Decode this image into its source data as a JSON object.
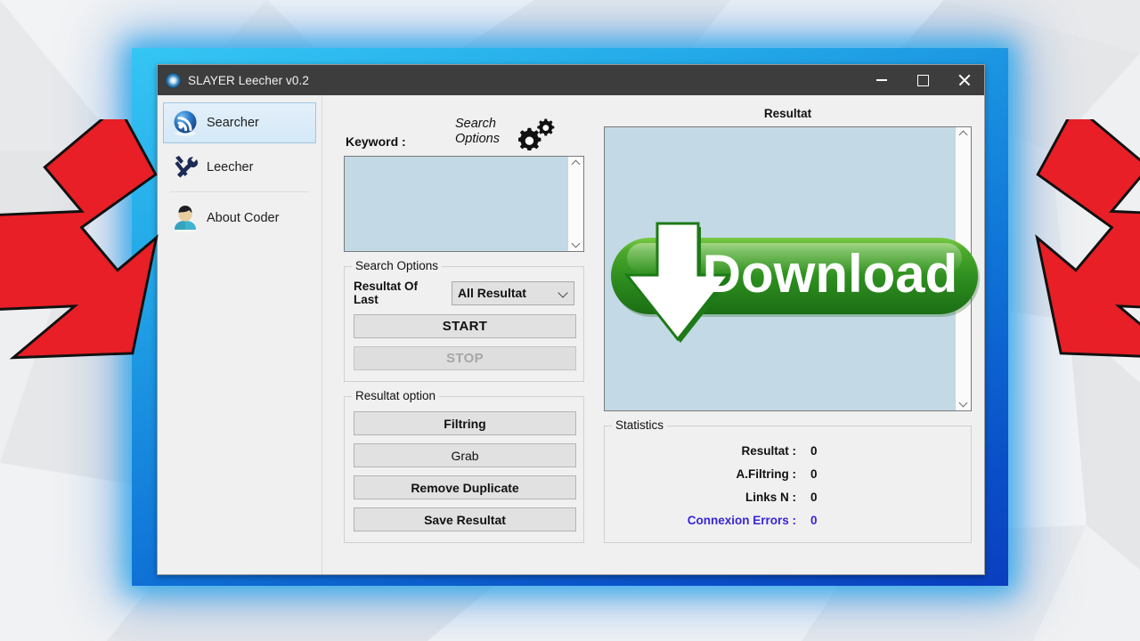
{
  "window": {
    "title": "SLAYER Leecher v0.2",
    "app_icon": "eye-icon",
    "controls": {
      "minimize": "minimize-icon",
      "maximize": "maximize-icon",
      "close": "close-icon"
    }
  },
  "sidebar": {
    "items": [
      {
        "label": "Searcher",
        "icon": "rss-sphere-icon",
        "selected": true
      },
      {
        "label": "Leecher",
        "icon": "hammer-wrench-icon",
        "selected": false
      },
      {
        "label": "About Coder",
        "icon": "person-icon",
        "selected": false
      }
    ]
  },
  "middle": {
    "keyword_label": "Keyword :",
    "search_options_link": "Search\nOptions",
    "search_options_line1": "Search",
    "search_options_line2": "Options",
    "gear_icon": "gears-icon",
    "keyword_value": "",
    "keyword_placeholder": "",
    "search_options_group": {
      "title": "Search Options",
      "result_of_last_label": "Resultat Of Last",
      "result_of_last_value": "All Resultat",
      "result_of_last_options": [
        "All Resultat"
      ],
      "start_label": "START",
      "stop_label": "STOP",
      "stop_disabled": true
    },
    "result_option_group": {
      "title": "Resultat option",
      "buttons": [
        "Filtring",
        "Grab",
        "Remove Duplicate",
        "Save Resultat"
      ]
    }
  },
  "right": {
    "result_title": "Resultat",
    "result_value": "",
    "overlay": {
      "label": "Download",
      "icon": "download-arrow-icon"
    },
    "statistics": {
      "title": "Statistics",
      "rows": [
        {
          "label": "Resultat :",
          "value": "0",
          "highlight": false
        },
        {
          "label": "A.Filtring :",
          "value": "0",
          "highlight": false
        },
        {
          "label": "Links N :",
          "value": "0",
          "highlight": false
        },
        {
          "label": "Connexion Errors :",
          "value": "0",
          "highlight": true
        }
      ]
    }
  },
  "annotations": {
    "left_arrow": "red-arrow-down-right",
    "right_arrow": "red-arrow-down-left"
  },
  "colors": {
    "titlebar": "#3d3d3d",
    "glow": "#1f8ee0",
    "textbox": "#c3d9e6",
    "accent_link": "#3a24d8",
    "download_green": "#2f9a26",
    "arrow_red": "#e81f26"
  }
}
